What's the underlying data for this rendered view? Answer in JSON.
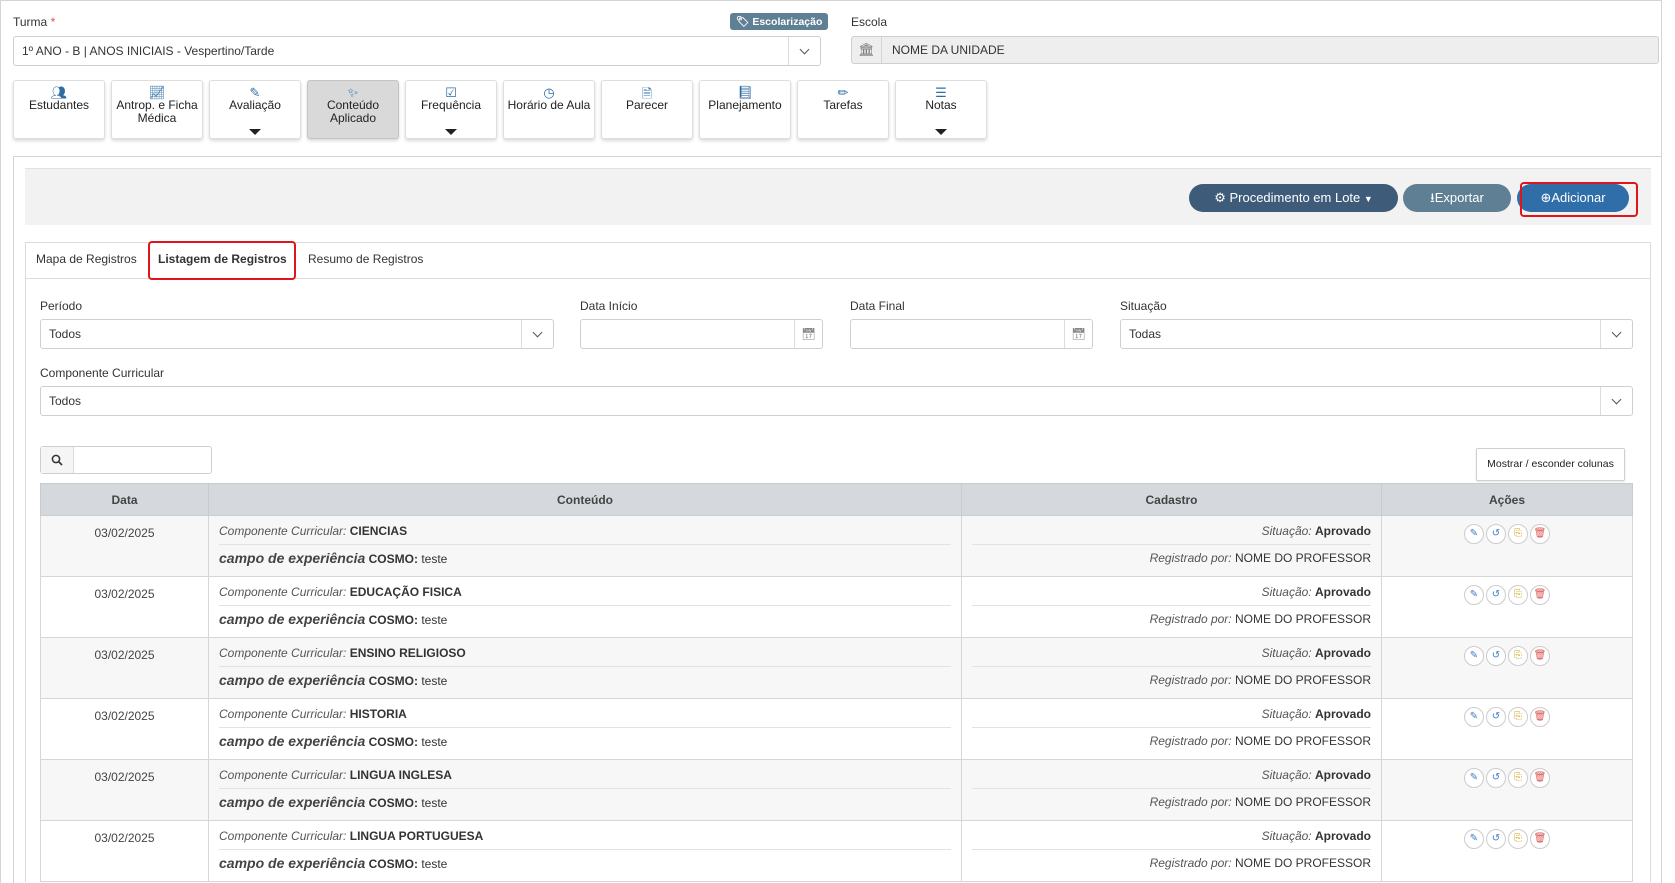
{
  "header": {
    "turma_label": "Turma",
    "turma_required_mark": "*",
    "badge_label": "Escolarização",
    "turma_value": "1º ANO - B | ANOS INICIAIS - Vespertino/Tarde",
    "escola_label": "Escola",
    "escola_value": "NOME DA UNIDADE"
  },
  "menu_tiles": [
    {
      "label": "Estudantes",
      "icon": "users-icon"
    },
    {
      "label": "Antrop. e Ficha Médica",
      "icon": "chart-line-icon"
    },
    {
      "label": "Avaliação",
      "icon": "edit-icon"
    },
    {
      "label": "Conteúdo Aplicado",
      "icon": "magic-wand-icon"
    },
    {
      "label": "Frequência",
      "icon": "check-square-icon"
    },
    {
      "label": "Horário de Aula",
      "icon": "clock-icon"
    },
    {
      "label": "Parecer",
      "icon": "file-icon"
    },
    {
      "label": "Planejamento",
      "icon": "book-icon"
    },
    {
      "label": "Tarefas",
      "icon": "pencil-icon"
    },
    {
      "label": "Notas",
      "icon": "list-icon"
    }
  ],
  "toolbar": {
    "lote_label": "Procedimento em Lote",
    "export_label": "Exportar",
    "add_label": "Adicionar"
  },
  "tabs": {
    "mapa": "Mapa de Registros",
    "listagem": "Listagem de Registros",
    "resumo": "Resumo de Registros"
  },
  "filters": {
    "periodo_label": "Período",
    "periodo_value": "Todos",
    "data_inicio_label": "Data Início",
    "data_final_label": "Data Final",
    "situacao_label": "Situação",
    "situacao_value": "Todas",
    "componente_label": "Componente Curricular",
    "componente_value": "Todos"
  },
  "columns_button": "Mostrar / esconder colunas",
  "table": {
    "headers": {
      "data": "Data",
      "conteudo": "Conteúdo",
      "cadastro": "Cadastro",
      "acoes": "Ações"
    },
    "cc_prefix": "Componente Curricular:",
    "ce_prefix": "campo de experiência",
    "cosmo_label": "COSMO:",
    "situacao_prefix": "Situação:",
    "registrado_prefix": "Registrado por:",
    "rows": [
      {
        "date": "03/02/2025",
        "componente": "CIENCIAS",
        "conteudo": "teste",
        "situacao": "Aprovado",
        "registrado": "NOME DO PROFESSOR"
      },
      {
        "date": "03/02/2025",
        "componente": "EDUCAÇÃO FISICA",
        "conteudo": "teste",
        "situacao": "Aprovado",
        "registrado": "NOME DO PROFESSOR"
      },
      {
        "date": "03/02/2025",
        "componente": "ENSINO RELIGIOSO",
        "conteudo": "teste",
        "situacao": "Aprovado",
        "registrado": "NOME DO PROFESSOR"
      },
      {
        "date": "03/02/2025",
        "componente": "HISTORIA",
        "conteudo": "teste",
        "situacao": "Aprovado",
        "registrado": "NOME DO PROFESSOR"
      },
      {
        "date": "03/02/2025",
        "componente": "LINGUA INGLESA",
        "conteudo": "teste",
        "situacao": "Aprovado",
        "registrado": "NOME DO PROFESSOR"
      },
      {
        "date": "03/02/2025",
        "componente": "LINGUA PORTUGUESA",
        "conteudo": "teste",
        "situacao": "Aprovado",
        "registrado": "NOME DO PROFESSOR"
      }
    ]
  },
  "colors": {
    "primary": "#2f6ea8",
    "dark_button": "#3e5c7a",
    "secondary_button": "#5f7f94",
    "highlight": "#e0141b",
    "header_bg": "#d5d9dd"
  }
}
